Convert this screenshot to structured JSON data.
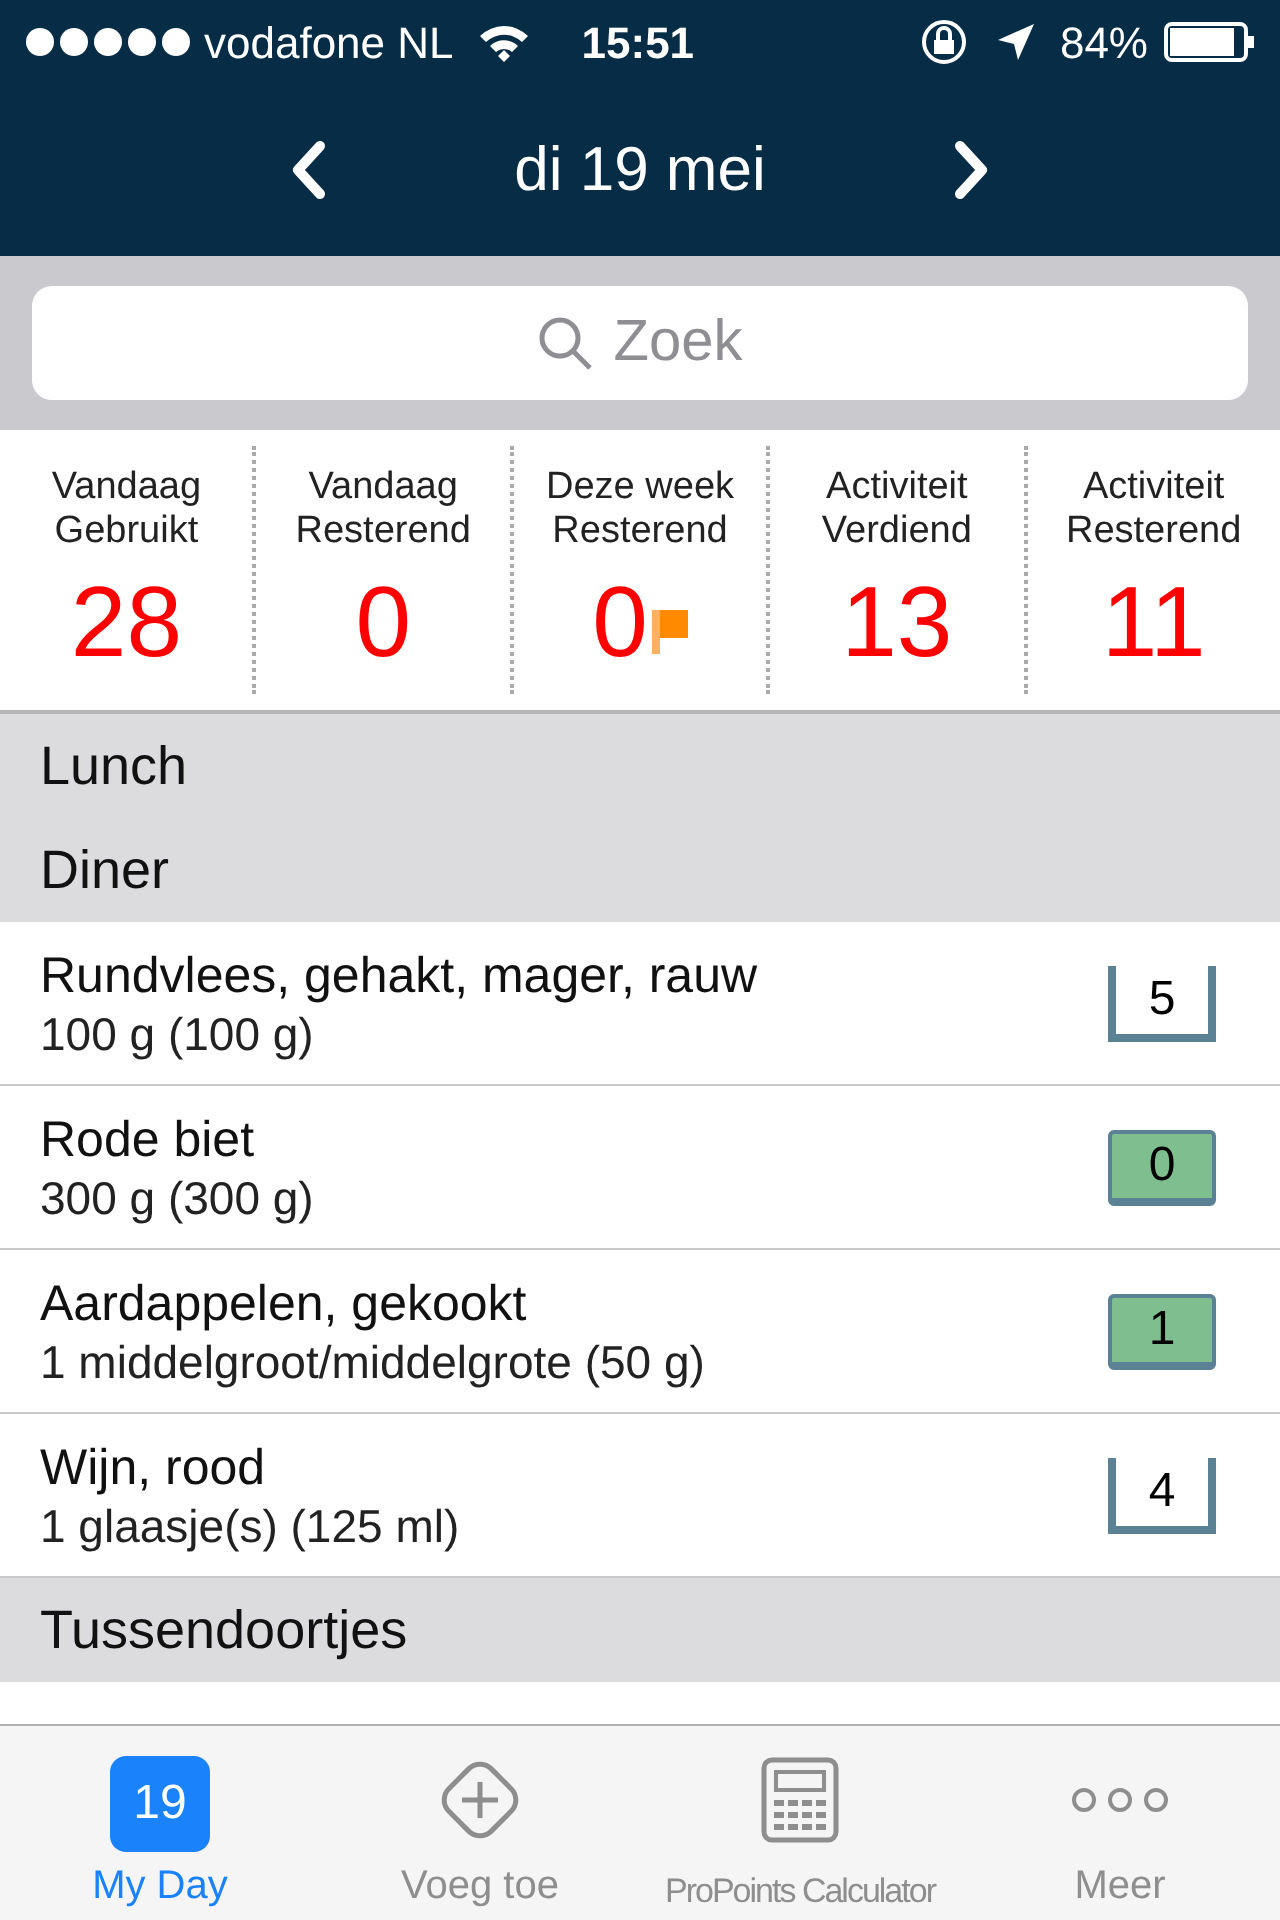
{
  "status_bar": {
    "carrier": "vodafone NL",
    "time": "15:51",
    "battery": "84%"
  },
  "nav": {
    "title": "di 19 mei"
  },
  "search": {
    "placeholder": "Zoek"
  },
  "stats": [
    {
      "label": "Vandaag Gebruikt",
      "value": "28",
      "flag": false
    },
    {
      "label": "Vandaag Resterend",
      "value": "0",
      "flag": false
    },
    {
      "label": "Deze week Resterend",
      "value": "0",
      "flag": true
    },
    {
      "label": "Activiteit Verdiend",
      "value": "13",
      "flag": false
    },
    {
      "label": "Activiteit Resterend",
      "value": "11",
      "flag": false
    }
  ],
  "list": [
    {
      "kind": "header",
      "title": "Lunch"
    },
    {
      "kind": "header",
      "title": "Diner"
    },
    {
      "kind": "item",
      "name": "Rundvlees, gehakt, mager, rauw",
      "amount": "100 g (100 g)",
      "points": "5",
      "highlighted": false
    },
    {
      "kind": "item",
      "name": "Rode biet",
      "amount": "300 g (300 g)",
      "points": "0",
      "highlighted": true
    },
    {
      "kind": "item",
      "name": "Aardappelen, gekookt",
      "amount": "1 middelgroot/middelgrote (50 g)",
      "points": "1",
      "highlighted": true
    },
    {
      "kind": "item",
      "name": "Wijn, rood",
      "amount": "1 glaasje(s) (125 ml)",
      "points": "4",
      "highlighted": false
    },
    {
      "kind": "header",
      "title": "Tussendoortjes"
    }
  ],
  "tab_bar": [
    {
      "label": "My Day",
      "icon_text": "19",
      "selected": true
    },
    {
      "label": "Voeg toe",
      "selected": false
    },
    {
      "label": "ProPoints Calculator",
      "selected": false
    },
    {
      "label": "Meer",
      "selected": false
    }
  ]
}
